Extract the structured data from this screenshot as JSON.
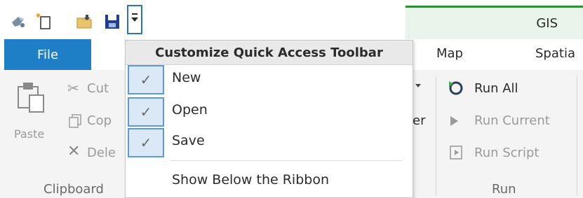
{
  "qat": {
    "icons": [
      "app-icon",
      "new-file-icon",
      "open-folder-icon",
      "save-disk-icon"
    ],
    "dropdown_icon": "customize-dropdown-icon"
  },
  "ribbon_right": {
    "contextual_tab": "GIS"
  },
  "tabs": {
    "file": "File",
    "map": "Map",
    "spatial": "Spatia"
  },
  "clipboard": {
    "paste": "Paste",
    "cut": "Cut",
    "copy": "Cop",
    "delete": "Dele",
    "group_label": "Clipboard"
  },
  "middle": {
    "fragment": "er"
  },
  "run": {
    "run_all": "Run All",
    "run_current": "Run Current",
    "run_script": "Run Script",
    "group_label": "Run"
  },
  "menu": {
    "header": "Customize Quick Access Toolbar",
    "items": [
      {
        "label": "New",
        "checked": true
      },
      {
        "label": "Open",
        "checked": true
      },
      {
        "label": "Save",
        "checked": true
      }
    ],
    "show_below": "Show Below the Ribbon"
  },
  "colors": {
    "file_tab": "#1f7fc6",
    "highlight_border": "#5b9bd5",
    "highlight_fill": "#dbe9f7",
    "gis_band": "#e9f4ea",
    "gis_line": "#2e8b36"
  }
}
